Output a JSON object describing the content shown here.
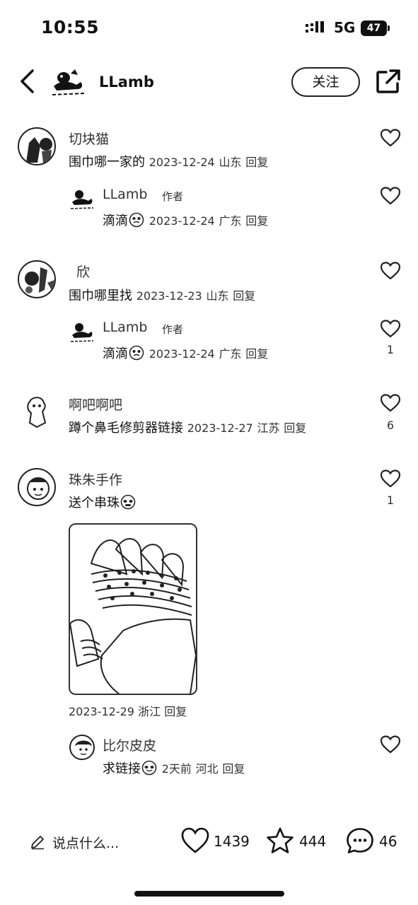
{
  "status_bar": {
    "time": "10:55",
    "network": "5G",
    "battery": "47"
  },
  "header": {
    "author": "LLamb",
    "follow_label": "关注",
    "icons": [
      "back-chevron-icon",
      "share-icon"
    ]
  },
  "comments": [
    {
      "name": "切块猫",
      "text": "围巾哪一家的",
      "date": "2023-12-24",
      "location": "山东",
      "reply_label": "回复",
      "likes": "",
      "replies": [
        {
          "name": "LLamb",
          "author_tag": "作者",
          "text": "滴滴",
          "date": "2023-12-24",
          "location": "广东",
          "reply_label": "回复",
          "likes": ""
        }
      ]
    },
    {
      "name": "欣",
      "text": "围巾哪里找",
      "date": "2023-12-23",
      "location": "山东",
      "reply_label": "回复",
      "likes": "",
      "replies": [
        {
          "name": "LLamb",
          "author_tag": "作者",
          "text": "滴滴",
          "date": "2023-12-24",
          "location": "广东",
          "reply_label": "回复",
          "likes": "1"
        }
      ]
    },
    {
      "name": "啊吧啊吧",
      "text": "蹲个鼻毛修剪器链接",
      "date": "2023-12-27",
      "location": "江苏",
      "reply_label": "回复",
      "likes": "6",
      "replies": []
    },
    {
      "name": "珠朱手作",
      "text": "送个串珠",
      "date": "2023-12-29",
      "location": "浙江",
      "reply_label": "回复",
      "likes": "1",
      "has_photo": true,
      "replies": [
        {
          "name": "比尔皮皮",
          "text": "求链接",
          "date": "2天前",
          "location": "河北",
          "reply_label": "回复",
          "likes": ""
        }
      ]
    }
  ],
  "bottom_bar": {
    "input_placeholder": "说点什么...",
    "likes": "1439",
    "favorites": "444",
    "comments": "46"
  }
}
